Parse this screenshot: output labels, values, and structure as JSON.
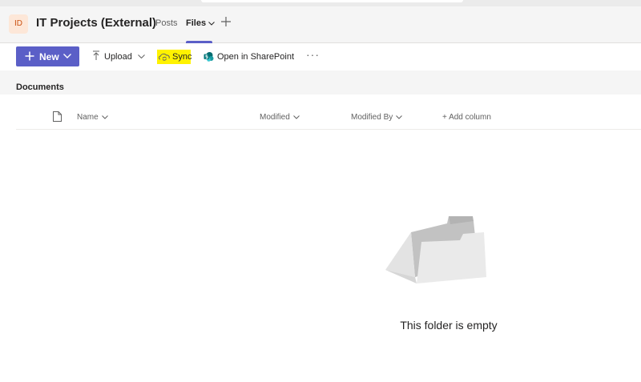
{
  "header": {
    "avatar_initials": "ID",
    "team_name": "IT Projects (External)",
    "tabs": [
      {
        "label": "Posts",
        "active": false
      },
      {
        "label": "Files",
        "active": true
      }
    ],
    "add_tab_icon": "plus-icon"
  },
  "toolbar": {
    "new_label": "New",
    "upload_label": "Upload",
    "sync_label": "Sync",
    "open_sharepoint_label": "Open in SharePoint",
    "more_label": "···"
  },
  "library": {
    "title": "Documents",
    "columns": {
      "name": "Name",
      "modified": "Modified",
      "modified_by": "Modified By",
      "add_column": "+ Add column"
    }
  },
  "empty_state": {
    "message": "This folder is empty",
    "illustration": "empty-folder-icon"
  },
  "colors": {
    "accent": "#5b5fc7",
    "sync_highlight": "#fff200",
    "avatar_bg": "#fde7d8",
    "avatar_fg": "#ca5010"
  }
}
